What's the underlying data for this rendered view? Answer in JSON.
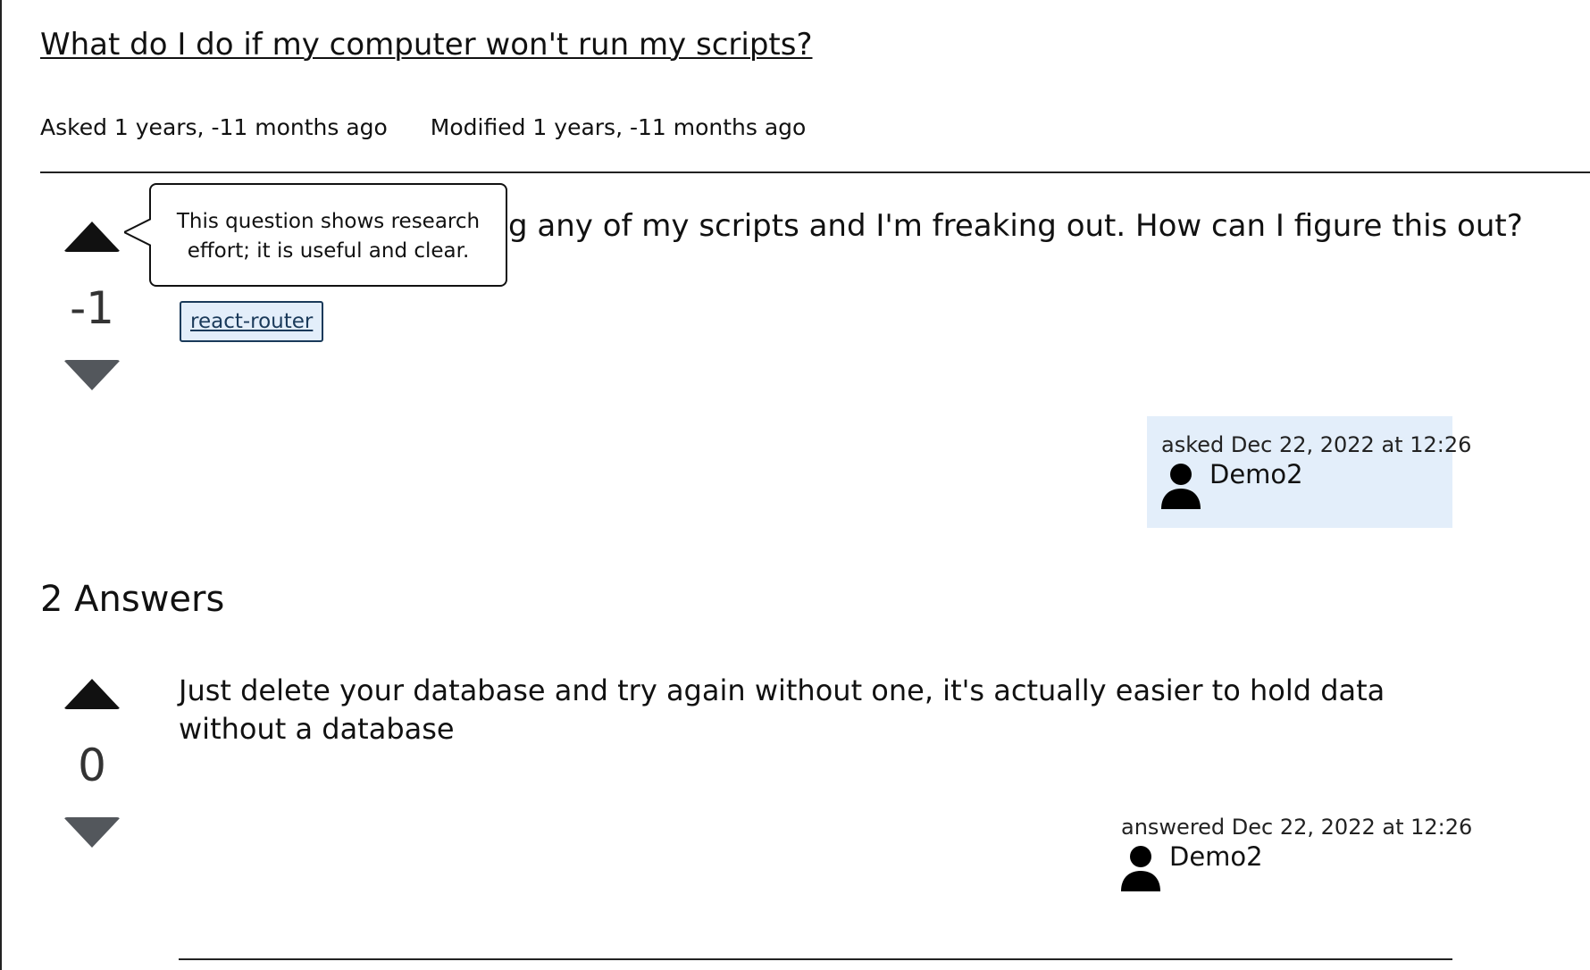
{
  "question": {
    "title": "What do I do if my computer won't run my scripts?",
    "asked_label": "Asked 1 years, -11 months ago",
    "modified_label": "Modified 1 years, -11 months ago",
    "body_visible": "g any of my scripts and I'm freaking out. How can I figure this out?",
    "vote_count": "-1",
    "tag": "react-router",
    "owner_time": "asked Dec 22, 2022 at 12:26",
    "owner_name": "Demo2"
  },
  "tooltip": {
    "text": "This question shows research effort; it is useful and clear."
  },
  "answers": {
    "heading": "2 Answers",
    "items": [
      {
        "body": "Just delete your database and try again without one, it's actually easier to hold data without a database",
        "vote_count": "0",
        "owner_time": "answered Dec 22, 2022 at 12:26",
        "owner_name": "Demo2"
      }
    ]
  },
  "colors": {
    "tag_bg": "#e3eefa",
    "owner_card_bg": "#e3eefa",
    "downvote": "#53575c"
  }
}
